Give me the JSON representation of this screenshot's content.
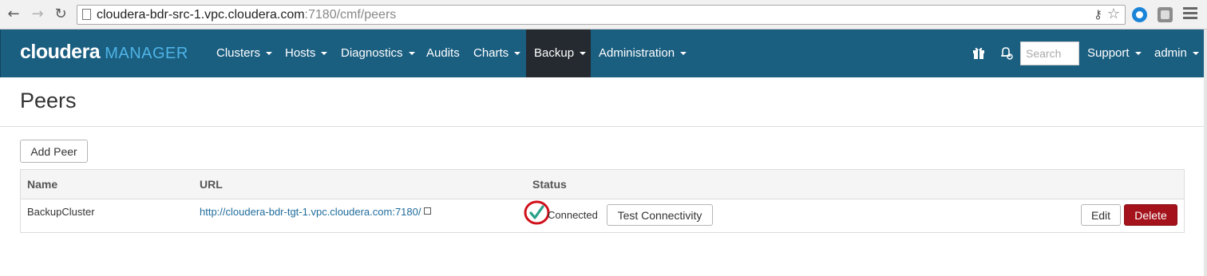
{
  "browser": {
    "url_host": "cloudera-bdr-src-1.vpc.cloudera.com",
    "url_path": ":7180/cmf/peers"
  },
  "app": {
    "logo_main": "cloudera",
    "logo_sub": "MANAGER",
    "nav": [
      {
        "label": "Clusters",
        "dropdown": true
      },
      {
        "label": "Hosts",
        "dropdown": true
      },
      {
        "label": "Diagnostics",
        "dropdown": true
      },
      {
        "label": "Audits",
        "dropdown": false
      },
      {
        "label": "Charts",
        "dropdown": true
      },
      {
        "label": "Backup",
        "dropdown": true,
        "active": true
      },
      {
        "label": "Administration",
        "dropdown": true
      }
    ],
    "search_placeholder": "Search",
    "support_label": "Support",
    "user_label": "admin",
    "colors": {
      "navbar": "#1a5e80",
      "active_tab": "#242a30",
      "logo_accent": "#4fb4e6",
      "danger": "#a4121b",
      "link": "#1f6c9c"
    }
  },
  "page": {
    "title": "Peers",
    "add_peer_label": "Add Peer",
    "table": {
      "columns": [
        "Name",
        "URL",
        "Status"
      ],
      "rows": [
        {
          "name": "BackupCluster",
          "url": "http://cloudera-bdr-tgt-1.vpc.cloudera.com:7180/",
          "status": "Connected",
          "test_label": "Test Connectivity",
          "edit_label": "Edit",
          "delete_label": "Delete"
        }
      ]
    }
  }
}
